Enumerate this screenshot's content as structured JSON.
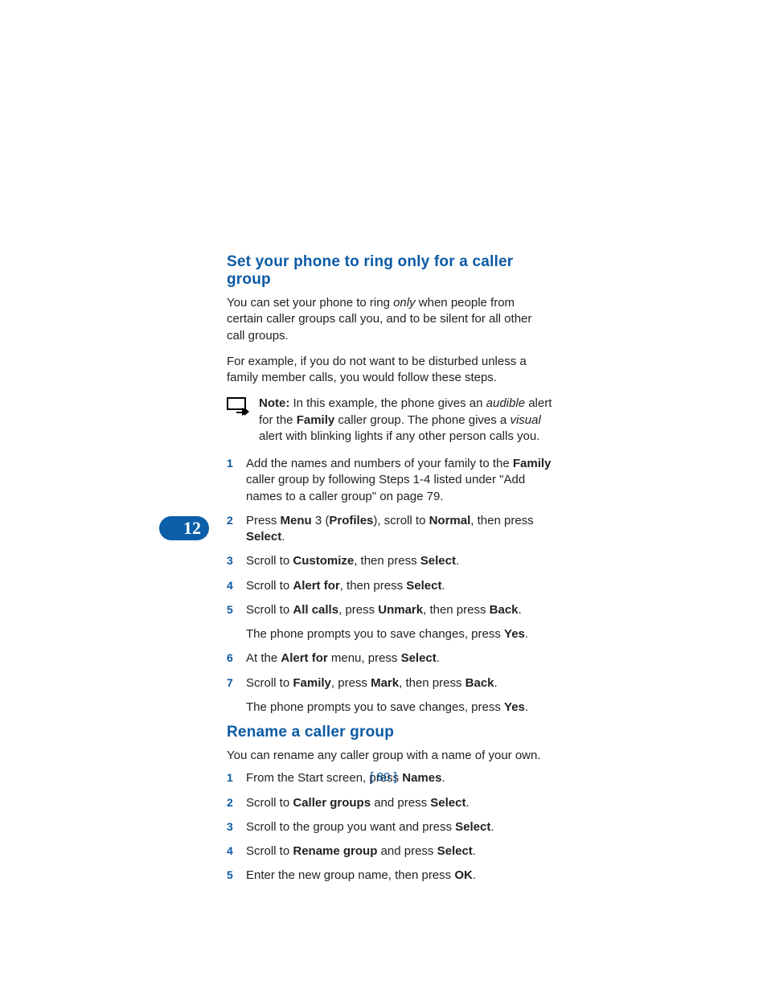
{
  "chapter": "12",
  "section1": {
    "title": "Set your phone to ring only for a caller group",
    "para1_a": "You can set your phone to ring ",
    "para1_i": "only",
    "para1_b": " when people from certain caller groups call you, and to be silent for all other call groups.",
    "para2": "For example, if you do not want to be disturbed unless a family member calls, you would follow these steps.",
    "note_label": "Note:",
    "note_a": " In this example, the phone gives an ",
    "note_i1": "audible",
    "note_b": " alert for the ",
    "note_bold1": "Family",
    "note_c": " caller group. The phone gives a ",
    "note_i2": "visual",
    "note_d": " alert with blinking lights if any other person calls you.",
    "steps": {
      "1": {
        "a": "Add the names and numbers of your family to the ",
        "b1": "Family",
        "b": " caller group by following Steps 1-4 listed under \"Add names to a caller group\" on page 79."
      },
      "2": {
        "a": "Press ",
        "b1": "Menu",
        "b": " 3 (",
        "b2": "Profiles",
        "c": "), scroll to ",
        "b3": "Normal",
        "d": ", then press ",
        "b4": "Select",
        "e": "."
      },
      "3": {
        "a": "Scroll to ",
        "b1": "Customize",
        "b": ", then press ",
        "b2": "Select",
        "c": "."
      },
      "4": {
        "a": "Scroll to ",
        "b1": "Alert for",
        "b": ", then press ",
        "b2": "Select",
        "c": "."
      },
      "5": {
        "a": "Scroll to ",
        "b1": "All calls",
        "b": ", press ",
        "b2": "Unmark",
        "c": ", then press ",
        "b3": "Back",
        "d": ".",
        "sub_a": "The phone prompts you to save changes, press ",
        "sub_b": "Yes",
        "sub_c": "."
      },
      "6": {
        "a": "At the ",
        "b1": "Alert for",
        "b": " menu, press ",
        "b2": "Select",
        "c": "."
      },
      "7": {
        "a": "Scroll to ",
        "b1": "Family",
        "b": ", press ",
        "b2": "Mark",
        "c": ", then press ",
        "b3": "Back",
        "d": ".",
        "sub_a": "The phone prompts you to save changes, press ",
        "sub_b": "Yes",
        "sub_c": "."
      }
    }
  },
  "section2": {
    "title": "Rename a caller group",
    "para1": "You can rename any caller group with a name of your own.",
    "steps": {
      "1": {
        "a": "From the Start screen, press ",
        "b1": "Names",
        "b": "."
      },
      "2": {
        "a": "Scroll to ",
        "b1": "Caller groups",
        "b": " and press ",
        "b2": "Select",
        "c": "."
      },
      "3": {
        "a": "Scroll to the group you want and press ",
        "b1": "Select",
        "b": "."
      },
      "4": {
        "a": "Scroll to ",
        "b1": "Rename group",
        "b": " and press ",
        "b2": "Select",
        "c": "."
      },
      "5": {
        "a": "Enter the new group name, then press ",
        "b1": "OK",
        "b": "."
      }
    }
  },
  "page_number": "[ 80 ]"
}
